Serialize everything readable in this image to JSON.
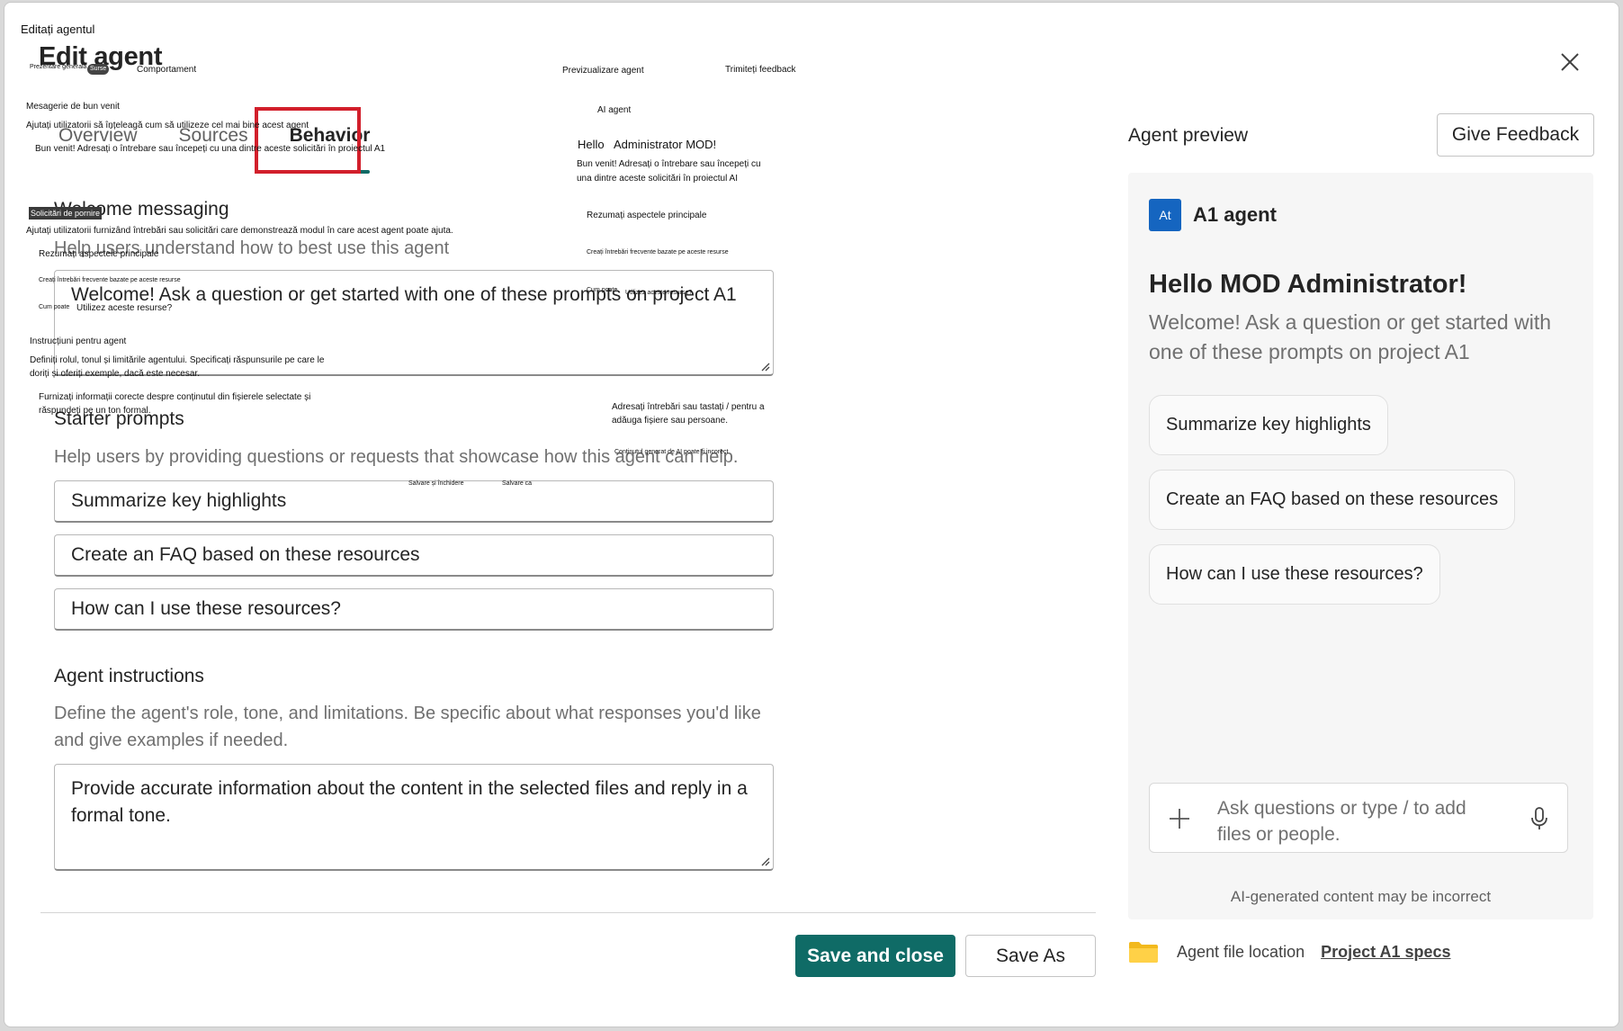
{
  "window": {
    "label": "Editați agentul",
    "title": "Edit agent",
    "close_icon": "close-icon"
  },
  "tabs": [
    {
      "label": "Overview"
    },
    {
      "label": "Sources"
    },
    {
      "label": "Behavior",
      "active": true
    }
  ],
  "welcome": {
    "title": "Welcome messaging",
    "description": "Help users understand how to best use this agent",
    "value": "Welcome! Ask a question or get started with one of these prompts on project A1"
  },
  "starter": {
    "title": "Starter prompts",
    "description": "Help users by providing questions or requests that showcase how this agent can help.",
    "prompts": [
      "Summarize key highlights",
      "Create an FAQ based on these resources",
      "How can I use these resources?"
    ]
  },
  "instructions": {
    "title": "Agent instructions",
    "description": "Define the agent's role, tone, and limitations. Be specific about what responses you'd like and give examples if needed.",
    "value": "Provide accurate information about the content in the selected files and reply in a formal tone."
  },
  "footer": {
    "save_close": "Save and close",
    "save_as": "Save As"
  },
  "preview": {
    "heading": "Agent preview",
    "feedback": "Give Feedback",
    "badge": "At",
    "agent_name": "A1 agent",
    "hello": "Hello MOD Administrator!",
    "welcome": "Welcome! Ask a question or get started with one of these prompts on project A1",
    "chips": [
      "Summarize key highlights",
      "Create an FAQ based on these resources",
      "How can I use these resources?"
    ],
    "ask_placeholder": "Ask questions or type / to add files or people.",
    "disclaimer": "AI-generated content may be incorrect",
    "accent": "#1565c0"
  },
  "file_location": {
    "label": "Agent file location",
    "link": "Project A1 specs"
  },
  "overlay": {
    "tab_general": "Prezentare generală",
    "tab_sources": "Surse",
    "tab_behavior": "Comportament",
    "preview": "Previzualizare agent",
    "feedback": "Trimiteți feedback",
    "welcome_title": "Mesagerie de bun venit",
    "welcome_desc": "Ajutați utilizatorii să înțeleagă cum să utilizeze cel mai bine acest agent",
    "welcome_value": "Bun venit! Adresați o întrebare sau începeți cu una dintre aceste solicitări în proiectul A1",
    "agent_name": "AI agent",
    "hello_a": "Hello",
    "hello_b": "Administrator MOD!",
    "preview_welcome": "Bun venit! Adresați o întrebare sau începeți cu una dintre aceste solicitări în proiectul AI",
    "starter_title": "Solicitări de pornire",
    "starter_desc": "Ajutați utilizatorii furnizând întrebări sau solicitări care demonstrează modul în care acest agent poate ajuta.",
    "p1": "Rezumați aspectele principale",
    "p2": "Creați întrebări frecvente bazate pe aceste resurse",
    "p3a": "Cum poate",
    "p3b": "Utilizez aceste resurse?",
    "c1": "Rezumați aspectele principale",
    "c2": "Creați întrebări frecvente bazate pe aceste resurse",
    "c3a": "Cum poate",
    "c3b": "Utilizez aceste resurse?",
    "instr_title": "Instrucțiuni pentru agent",
    "instr_desc": "Definiți rolul, tonul și limitările agentului. Specificați răspunsurile pe care le doriți și oferiți exemple, dacă este necesar.",
    "instr_value": "Furnizați informații corecte despre conținutul din fișierele selectate și răspundeți pe un ton formal.",
    "ask": "Adresați întrebări sau tastați / pentru a adăuga fișiere sau persoane.",
    "disclaimer": "Conținutul generat de AI poate fi incorect",
    "save_close": "Salvare și închidere",
    "save_as": "Salvare ca"
  }
}
